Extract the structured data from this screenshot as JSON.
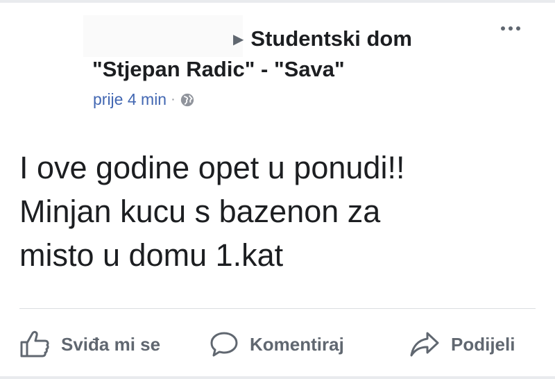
{
  "header": {
    "group_arrow": "▶",
    "group_name_line1": "Studentski dom",
    "group_name_line2": "\"Stjepan Radic\" - \"Sava\"",
    "timestamp": "prije 4 min",
    "separator": "·",
    "privacy_icon": "globe-icon",
    "more_icon": "more-options-icon"
  },
  "post": {
    "lines": [
      "I ove godine opet u ponudi!!",
      "Minjan kucu s bazenon za",
      "misto u domu 1.kat"
    ]
  },
  "actions": {
    "like_label": "Sviđa mi se",
    "comment_label": "Komentiraj",
    "share_label": "Podijeli"
  },
  "colors": {
    "link_blue": "#4267b2",
    "text": "#1c1e21",
    "secondary": "#606770"
  }
}
